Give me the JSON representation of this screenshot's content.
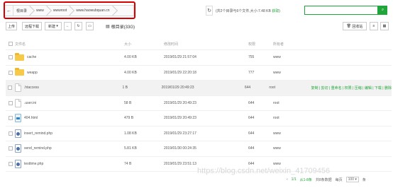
{
  "breadcrumb": {
    "items": [
      "根目录",
      "www",
      "wwwroot",
      "www.haowubquan.cn"
    ]
  },
  "summary": {
    "text": "共2个目录与6个文件,大小:7.48 KB",
    "link": "获取"
  },
  "toolbar": {
    "upload": "上传",
    "remote_download": "远程下载",
    "new": "新建",
    "disk": "根目录(33G)",
    "recycle": "回收站"
  },
  "columns": {
    "name": "文件名",
    "size": "大小",
    "mtime": "修改时间",
    "perm": "权限",
    "owner": "所有者"
  },
  "files": [
    {
      "type": "folder",
      "name": "cache",
      "size": "4.00 KB",
      "mtime": "2019/01/29 21:57:04",
      "perm": "755",
      "owner": "www"
    },
    {
      "type": "folder",
      "name": "weapp",
      "size": "4.00 KB",
      "mtime": "2019/01/29 22:20:18",
      "perm": "777",
      "owner": "www"
    },
    {
      "type": "file",
      "name": ".htaccess",
      "size": "1 B",
      "mtime": "2019/01/29 20:49:23",
      "perm": "644",
      "owner": "root",
      "ops": "复制 | 剪切 | 重命名 | 权限 | 压缩 | 编辑 | 下载 | 删除"
    },
    {
      "type": "file",
      "name": ".user.ini",
      "size": "58 B",
      "mtime": "2019/01/29 20:49:23",
      "perm": "644",
      "owner": "root"
    },
    {
      "type": "html",
      "name": "404.html",
      "size": "479 B",
      "mtime": "2019/01/29 20:49:23",
      "perm": "644",
      "owner": "root"
    },
    {
      "type": "php",
      "name": "insert_remind.php",
      "size": "1.08 KB",
      "mtime": "2019/01/29 23:27:17",
      "perm": "644",
      "owner": "www"
    },
    {
      "type": "php",
      "name": "send_remind.php",
      "size": "5.81 KB",
      "mtime": "2019/01/30 00:24:35",
      "perm": "644",
      "owner": "www"
    },
    {
      "type": "php",
      "name": "testtime.php",
      "size": "74 B",
      "mtime": "2019/01/29 23:51:13",
      "perm": "644",
      "owner": "www"
    }
  ],
  "pager": {
    "prev": "‹",
    "current": "1/1",
    "range": "从1-8条",
    "total": "共8条数据",
    "per_page_label": "每页",
    "per_page": "100",
    "unit": "条"
  },
  "watermark": "https://blog.csdn.net/weixin_41709456"
}
